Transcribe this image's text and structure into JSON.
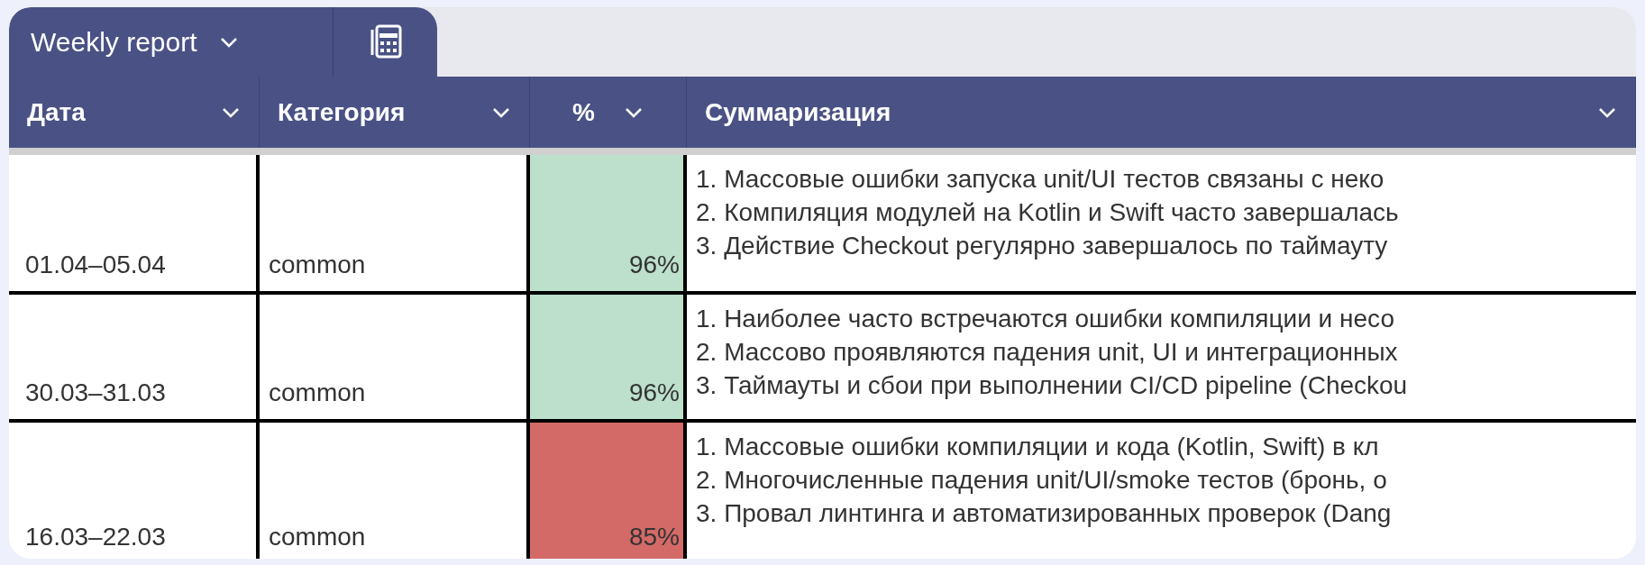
{
  "tabs": [
    {
      "label": "Weekly report",
      "kind": "dropdown"
    },
    {
      "kind": "calculator"
    }
  ],
  "table": {
    "columns": [
      {
        "label": "Дата"
      },
      {
        "label": "Категория"
      },
      {
        "label": "%"
      },
      {
        "label": "Суммаризация"
      }
    ],
    "rows": [
      {
        "date": "01.04–05.04",
        "category": "common",
        "percent": "96%",
        "color": "#bde0cc",
        "summary": [
          "1. Массовые ошибки запуска unit/UI тестов связаны с неко",
          "2. Компиляция модулей на Kotlin и Swift часто завершалась",
          "3. Действие Checkout регулярно завершалось по таймауту"
        ]
      },
      {
        "date": "30.03–31.03",
        "category": "common",
        "percent": "96%",
        "color": "#bde0cc",
        "summary": [
          "1. Наиболее часто встречаются ошибки компиляции и несо",
          "2. Массово проявляются падения unit, UI и интеграционных",
          "3. Таймауты и сбои при выполнении CI/CD pipeline (Checkou"
        ]
      },
      {
        "date": "16.03–22.03",
        "category": "common",
        "percent": "85%",
        "color": "#d46a67",
        "summary": [
          "1. Массовые ошибки компиляции и кода (Kotlin, Swift) в кл",
          "2. Многочисленные падения unit/UI/smoke тестов (бронь, о",
          "3. Провал линтинга и автоматизированных проверок (Dang"
        ]
      }
    ]
  }
}
